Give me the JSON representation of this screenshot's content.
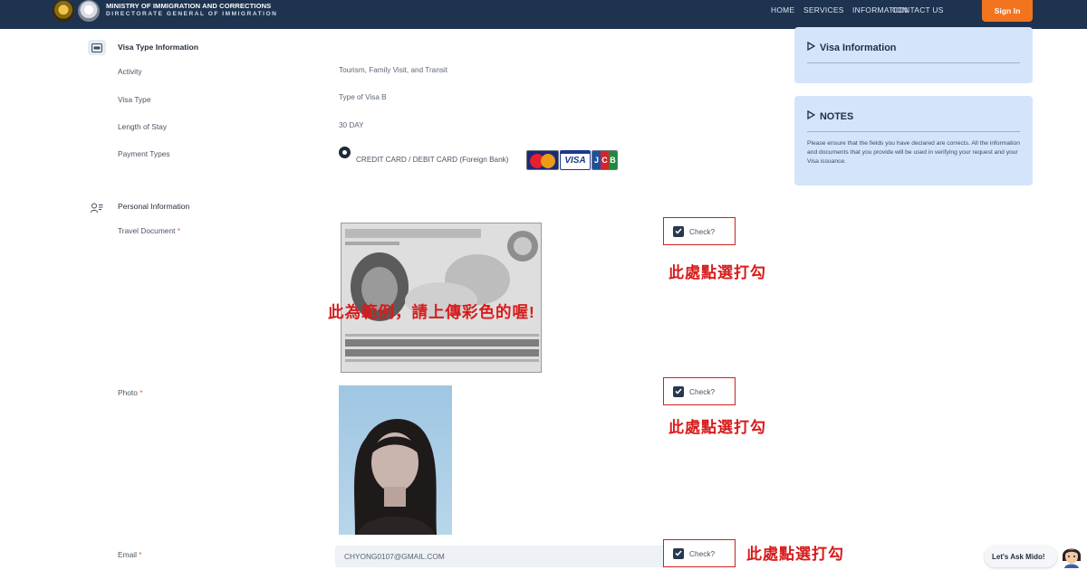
{
  "header": {
    "ministry": "MINISTRY OF IMMIGRATION AND CORRECTIONS",
    "directorate": "DIRECTORATE GENERAL OF IMMIGRATION",
    "nav": [
      "HOME",
      "SERVICES",
      "INFORMATION",
      "CONTACT US"
    ],
    "signin": "Sign In"
  },
  "visa_section": {
    "title": "Visa Type Information",
    "rows": [
      {
        "label": "Activity",
        "value": "Tourism, Family Visit, and Transit"
      },
      {
        "label": "Visa Type",
        "value": "Type of Visa B"
      },
      {
        "label": "Length of Stay",
        "value": "30 DAY"
      }
    ],
    "payment_label": "Payment Types",
    "payment_option": "CREDIT CARD / DEBIT CARD (Foreign Bank)",
    "cards": {
      "visa": "VISA",
      "jcb": [
        "J",
        "C",
        "B"
      ]
    }
  },
  "personal_section": {
    "title": "Personal Information",
    "travel_document_label": "Travel Document",
    "photo_label": "Photo",
    "email_label": "Email",
    "required_mark": "*",
    "email_value": "CHYONG0107@GMAIL.COM"
  },
  "checks": {
    "label": "Check?"
  },
  "annotations": {
    "check_here": "此處點選打勾",
    "example": "此為範例，請上傳彩色的喔!"
  },
  "side": {
    "visa_info_title": "Visa Information",
    "notes_title": "NOTES",
    "notes_text": "Please ensure that the fields you have declared are corrects. All the information and documents that you provide will be used in verifying your request and your Visa issuance."
  },
  "chat": {
    "label": "Let's Ask Mido!"
  },
  "colors": {
    "navy": "#1d3350",
    "accent": "#f2741e",
    "panel": "#d4e4fb",
    "annotation": "#d81b1b"
  }
}
